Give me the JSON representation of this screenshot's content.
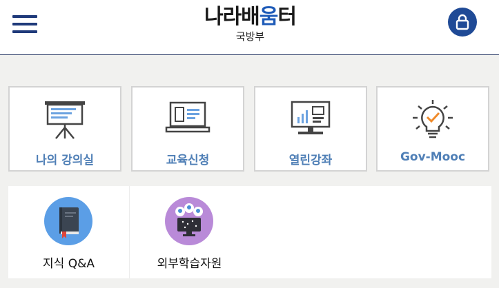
{
  "header": {
    "logo_text_before": "나라배",
    "logo_text_accent": "움",
    "logo_text_after": "터",
    "logo_subtitle": "국방부",
    "menu_icon": "hamburger-menu-icon",
    "lock_icon": "lock-icon",
    "brand_color": "#1f4a96"
  },
  "tiles": [
    {
      "label": "나의 강의실",
      "icon": "presentation-board-icon"
    },
    {
      "label": "교육신청",
      "icon": "laptop-icon"
    },
    {
      "label": "열린강좌",
      "icon": "monitor-chart-icon"
    },
    {
      "label": "Gov-Mooc",
      "icon": "lightbulb-check-icon"
    }
  ],
  "panel": [
    {
      "label": "지식 Q&A",
      "icon": "book-icon",
      "color": "#5b9ee6"
    },
    {
      "label": "외부학습자원",
      "icon": "people-network-icon",
      "color": "#b98ad8"
    }
  ],
  "colors": {
    "tile_label": "#4f7fb6",
    "icon_orange": "#f08a2a"
  }
}
